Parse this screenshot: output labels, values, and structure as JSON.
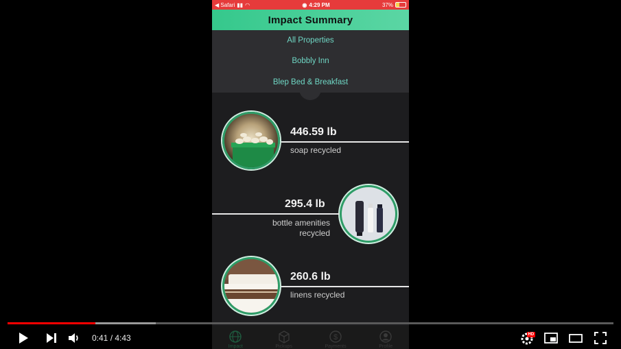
{
  "statusbar": {
    "carrier": "◀ Safari",
    "time": "4:29 PM",
    "battery": "37%",
    "battery_level": 0.37
  },
  "app": {
    "title": "Impact Summary",
    "properties": [
      "All Properties",
      "Bobbly Inn",
      "Blep Bed & Breakfast"
    ],
    "stats": [
      {
        "value": "446.59 lb",
        "label": "soap recycled",
        "image": "soap-bin-image"
      },
      {
        "value": "295.4 lb",
        "label_line1": "bottle amenities",
        "label_line2": "recycled",
        "image": "amenity-bottles-image"
      },
      {
        "value": "260.6 lb",
        "label": "linens recycled",
        "image": "hotel-bed-image"
      }
    ],
    "tabs": [
      {
        "label": "Impact",
        "icon": "globe-icon"
      },
      {
        "label": "Pickups",
        "icon": "box-icon"
      },
      {
        "label": "Payments",
        "icon": "dollar-icon"
      },
      {
        "label": "Profile",
        "icon": "user-icon"
      }
    ]
  },
  "video": {
    "current_time": "0:41",
    "separator": " / ",
    "duration": "4:43",
    "played_fraction": 0.145,
    "buffered_fraction": 0.245,
    "hd_badge": "HD",
    "accent": "#ff0000"
  }
}
